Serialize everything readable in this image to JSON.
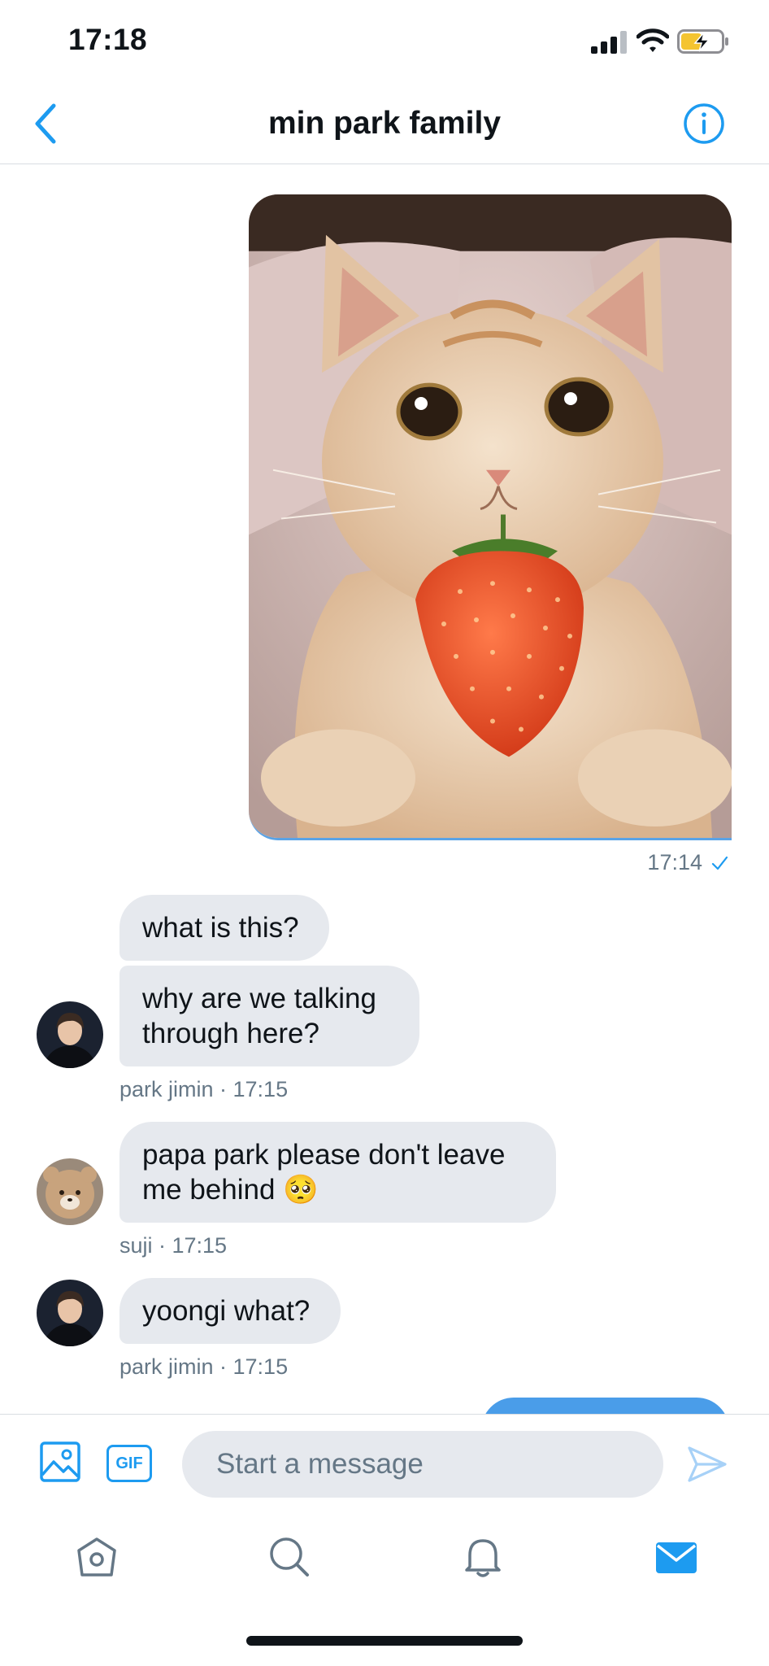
{
  "status_bar": {
    "time": "17:18",
    "icons": [
      "cellular-signal-icon",
      "wifi-icon",
      "battery-charging-icon"
    ]
  },
  "header": {
    "title": "min park family",
    "back_icon": "chevron-left-icon",
    "info_icon": "info-circle-icon"
  },
  "thread": {
    "photo_message": {
      "image": "photo of an orange tabby cat holding a strawberry in its mouth",
      "time": "17:14",
      "status_icon": "sent-check-icon"
    },
    "messages": [
      {
        "sender": "park jimin",
        "text": "what is this?"
      },
      {
        "sender": "park jimin",
        "text": "why are we talking through here?"
      },
      {
        "sender": "suji",
        "text": "papa park please don't leave me behind 🥺"
      },
      {
        "sender": "park jimin",
        "text": "yoongi what?"
      }
    ],
    "meta": [
      "park jimin · 17:15",
      "suji · 17:15",
      "park jimin · 17:15"
    ]
  },
  "composer": {
    "media_icon": "image-icon",
    "gif_label": "GIF",
    "placeholder": "Start a message",
    "send_icon": "send-icon"
  },
  "tabbar": {
    "items": [
      "home-icon",
      "search-icon",
      "notifications-bell-icon",
      "messages-mail-icon"
    ],
    "active": "messages-mail-icon"
  },
  "colors": {
    "accent": "#1d9bf0",
    "bubble_received": "#e6e9ee",
    "secondary_text": "#657786"
  }
}
